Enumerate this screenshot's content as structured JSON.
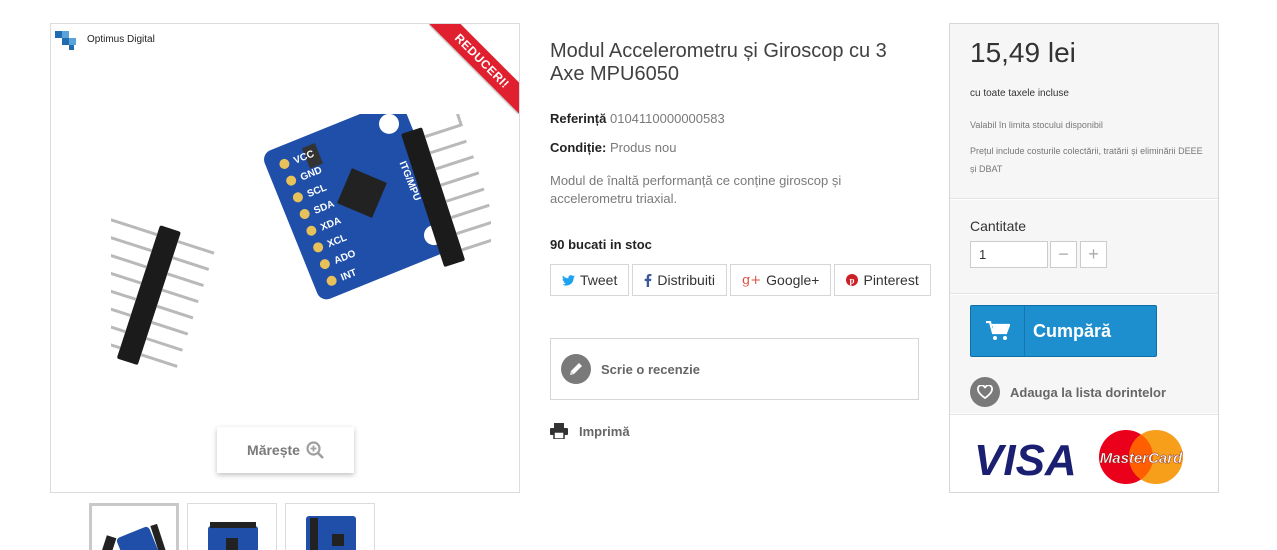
{
  "brand": {
    "name": "Optimus Digital"
  },
  "ribbon": {
    "label": "REDUCERI!"
  },
  "gallery": {
    "zoom_label": "Mărește",
    "thumbnail_count": 3
  },
  "product": {
    "title": "Modul Accelerometru și Giroscop cu 3 Axe MPU6050",
    "reference_label": "Referință",
    "reference_value": "0104110000000583",
    "condition_label": "Condiție:",
    "condition_value": "Produs nou",
    "description": "Modul de înaltă performanță ce conține giroscop și accelerometru triaxial.",
    "stock": "90 bucati in stoc",
    "board_pins": [
      "VCC",
      "GND",
      "SCL",
      "SDA",
      "XDA",
      "XCL",
      "ADO",
      "INT"
    ],
    "board_label": "ITG/MPU"
  },
  "share": [
    {
      "icon": "twitter-icon",
      "label": "Tweet",
      "color": "#1da1f2"
    },
    {
      "icon": "facebook-icon",
      "label": "Distribuiti",
      "color": "#3b5998"
    },
    {
      "icon": "google-plus-icon",
      "label": "Google+",
      "color": "#dd4b39"
    },
    {
      "icon": "pinterest-icon",
      "label": "Pinterest",
      "color": "#cb2027"
    }
  ],
  "review": {
    "label": "Scrie o recenzie"
  },
  "print": {
    "label": "Imprimă"
  },
  "pricing": {
    "price": "15,49 lei",
    "tax_note": "cu toate taxele incluse",
    "availability": "Valabil în limita stocului disponibil",
    "deee_note": "Prețul include costurile colectării, tratării și eliminării DEEE și DBAT"
  },
  "quantity": {
    "label": "Cantitate",
    "value": "1",
    "minus": "−",
    "plus": "+"
  },
  "cart": {
    "buy_label": "Cumpără",
    "wishlist_label": "Adauga la lista dorintelor"
  },
  "payment": {
    "visa": "VISA",
    "mastercard": "MasterCard"
  },
  "colors": {
    "accent": "#1d8fcf",
    "ribbon": "#e0202e",
    "board": "#1f4fa8"
  }
}
